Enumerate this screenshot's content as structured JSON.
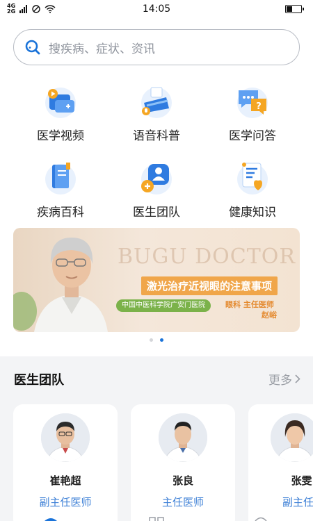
{
  "status_bar": {
    "signal_top": "4G",
    "signal_bottom": "2G",
    "time": "14:05"
  },
  "search": {
    "placeholder": "搜疾病、症状、资讯",
    "icon": "search-icon"
  },
  "categories": [
    {
      "label": "医学视频",
      "icon": "video-icon"
    },
    {
      "label": "语音科普",
      "icon": "voice-icon"
    },
    {
      "label": "医学问答",
      "icon": "qa-icon"
    },
    {
      "label": "疾病百科",
      "icon": "encyclopedia-icon"
    },
    {
      "label": "医生团队",
      "icon": "doctor-team-icon"
    },
    {
      "label": "健康知识",
      "icon": "health-knowledge-icon"
    }
  ],
  "banner": {
    "brand": "BUGU DOCTOR",
    "title": "激光治疗近视眼的注意事项",
    "hospital": "中国中医科学院广安门医院",
    "department": "眼科  主任医师",
    "doctor_name": "赵峪"
  },
  "carousel": {
    "count": 2,
    "active_index": 1
  },
  "doctor_section": {
    "title": "医生团队",
    "more_label": "更多"
  },
  "doctors": [
    {
      "name": "崔艳超",
      "title": "副主任医师"
    },
    {
      "name": "张良",
      "title": "主任医师"
    },
    {
      "name": "张雯",
      "title": "副主任医师"
    }
  ],
  "colors": {
    "accent": "#1a73d9",
    "icon_blue": "#2f7be0",
    "icon_orange": "#f5a623",
    "doctor_title": "#3c7fd6"
  }
}
